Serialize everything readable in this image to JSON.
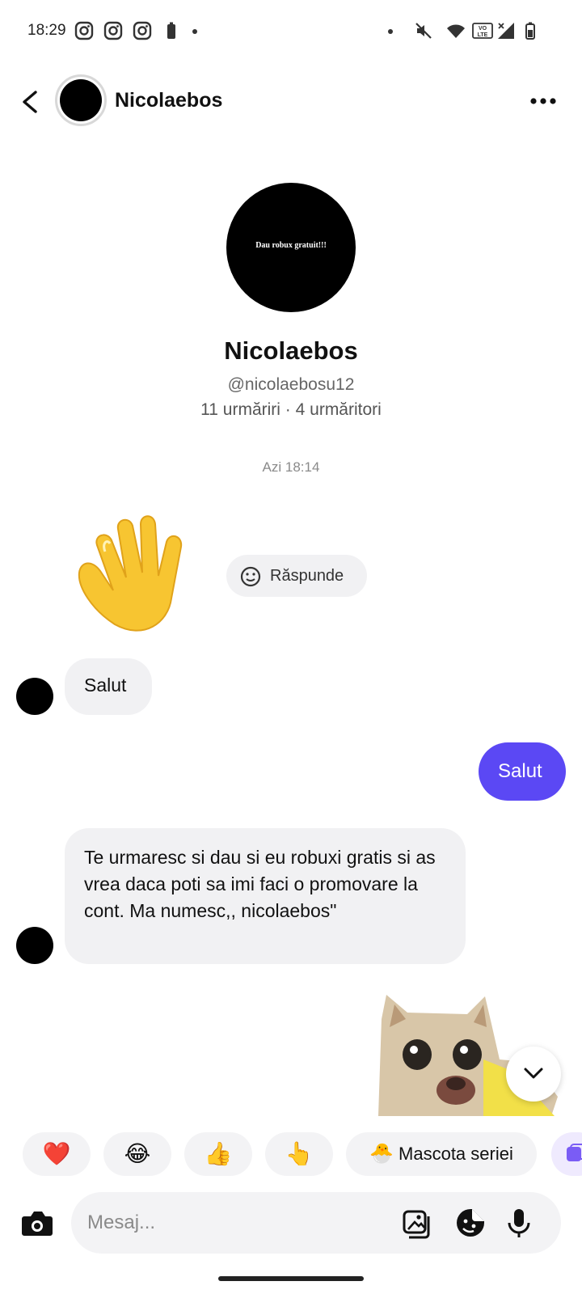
{
  "status_bar": {
    "time": "18:29",
    "left_icons": [
      "instagram-icon",
      "instagram-icon",
      "instagram-icon",
      "battery-saver-icon",
      "dot-icon"
    ],
    "right_icons": [
      "dot-icon",
      "mute-icon",
      "wifi-icon",
      "volte-icon",
      "signal-icon",
      "battery-icon"
    ],
    "volte_label": "VO LTE"
  },
  "header": {
    "name": "Nicolaebos"
  },
  "profile": {
    "avatar_text": "Dau robux gratuit!!!",
    "name": "Nicolaebos",
    "handle": "@nicolaebosu12",
    "stats": "11 urmăriri · 4 urmăritori"
  },
  "conversation": {
    "timestamp": "Azi 18:14",
    "reply_label": "Răspunde",
    "messages": [
      {
        "from": "them",
        "type": "sticker",
        "sticker": "waving-hand"
      },
      {
        "from": "them",
        "type": "text",
        "text": "Salut"
      },
      {
        "from": "me",
        "type": "text",
        "text": "Salut"
      },
      {
        "from": "them",
        "type": "text",
        "text": "Te urmaresc si dau si eu robuxi gratis si as vrea daca poti sa imi faci o promovare la cont. Ma numesc,, nicolaebos\""
      },
      {
        "from": "me",
        "type": "sticker",
        "sticker": "cat-meme"
      }
    ]
  },
  "quick_reactions": {
    "items": [
      "❤️",
      "😂",
      "👍",
      "👆"
    ],
    "mascot_label": "Mascota seriei",
    "mascot_emoji": "🐣"
  },
  "composer": {
    "placeholder": "Mesaj..."
  },
  "colors": {
    "accent": "#5b48f4",
    "incoming_bubble": "#f1f1f3"
  }
}
